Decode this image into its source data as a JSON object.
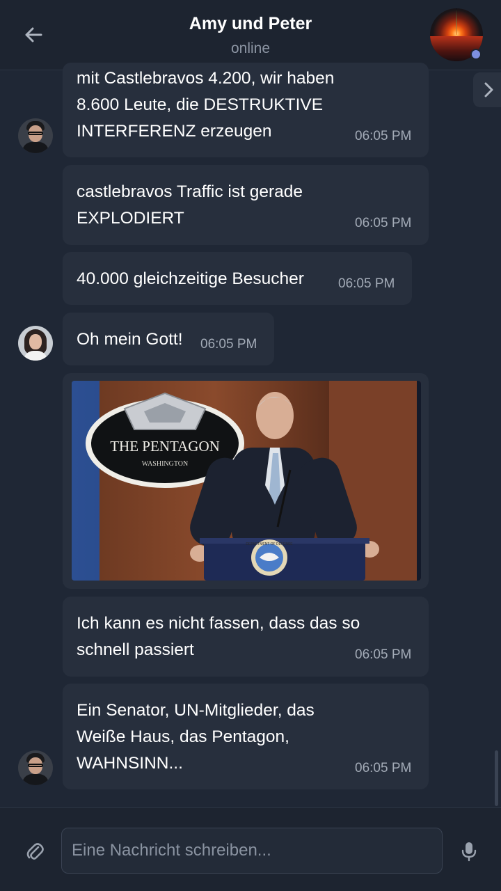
{
  "header": {
    "title": "Amy und Peter",
    "status": "online",
    "back_icon": "arrow-left-icon",
    "side_icon": "chevron-right-icon"
  },
  "messages": [
    {
      "text": "mit Castlebravos 4.200, wir haben\n8.600 Leute, die DESTRUKTIVE\nINTERFERENZ erzeugen",
      "time": "06:05 PM",
      "sender": "peter"
    },
    {
      "text": "castlebravos Traffic ist gerade\nEXPLODIERT",
      "time": "06:05 PM",
      "sender": "peter"
    },
    {
      "text": "40.000 gleichzeitige Besucher",
      "time": "06:05 PM",
      "sender": "peter"
    },
    {
      "text": "Oh mein Gott!",
      "time": "06:05 PM",
      "sender": "amy"
    },
    {
      "type": "image",
      "sign_title": "THE PENTAGON",
      "sign_subtitle": "WASHINGTON",
      "seal_text": "DEPARTMENT OF DEFENSE"
    },
    {
      "text": "Ich kann es nicht fassen, dass das so\nschnell passiert",
      "time": "06:05 PM",
      "sender": "peter"
    },
    {
      "text": "Ein Senator, UN-Mitglieder, das\nWeiße Haus, das Pentagon,\nWAHNSINN...",
      "time": "06:05 PM",
      "sender": "peter"
    }
  ],
  "composer": {
    "placeholder": "Eine Nachricht schreiben...",
    "value": "",
    "attach_icon": "paperclip-icon",
    "mic_icon": "microphone-icon"
  },
  "colors": {
    "background": "#1f2735",
    "bubble": "#272f3d",
    "timestamp": "#a3abb7",
    "status": "#8c95a3",
    "online_dot": "#7d8fe0"
  }
}
